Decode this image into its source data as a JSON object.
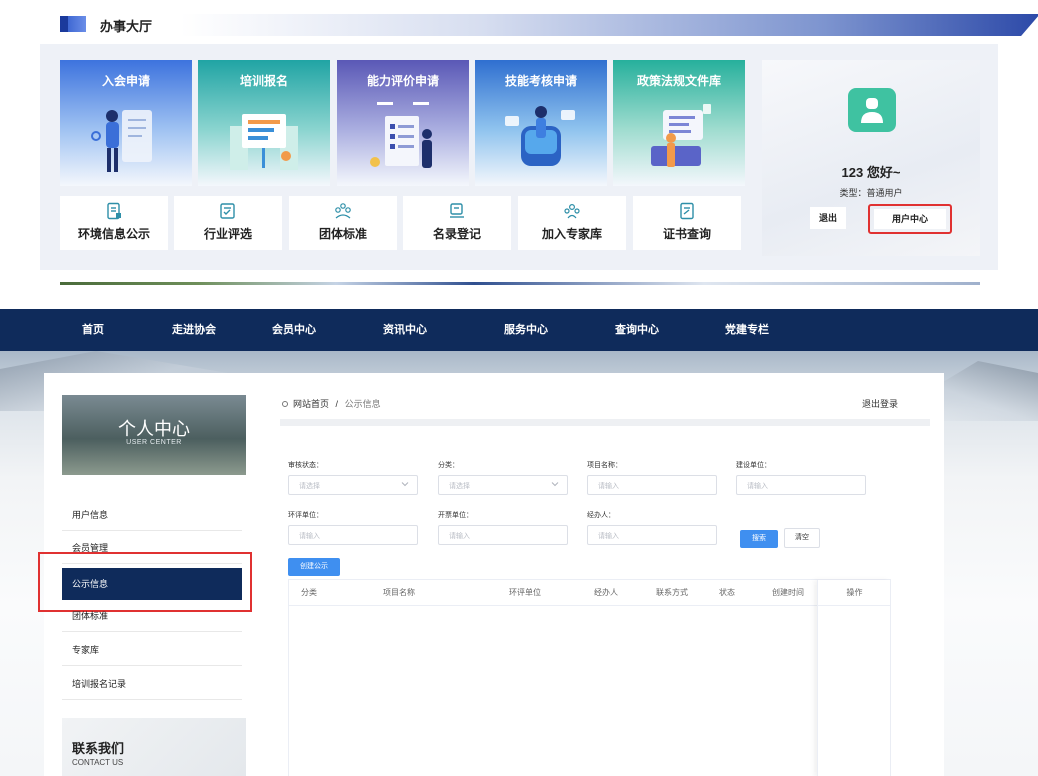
{
  "hall": {
    "title": "办事大厅",
    "tiles": [
      {
        "label": "入会申请",
        "icon": "member-application-icon"
      },
      {
        "label": "培训报名",
        "icon": "training-registration-icon"
      },
      {
        "label": "能力评价申请",
        "icon": "ability-evaluation-icon"
      },
      {
        "label": "技能考核申请",
        "icon": "skill-assessment-icon"
      },
      {
        "label": "政策法规文件库",
        "icon": "policy-library-icon"
      }
    ],
    "services": [
      {
        "label": "环境信息公示",
        "icon": "document-icon"
      },
      {
        "label": "行业评选",
        "icon": "checklist-icon"
      },
      {
        "label": "团体标准",
        "icon": "group-icon"
      },
      {
        "label": "名录登记",
        "icon": "registry-icon"
      },
      {
        "label": "加入专家库",
        "icon": "experts-icon"
      },
      {
        "label": "证书查询",
        "icon": "certificate-icon"
      }
    ],
    "user": {
      "greeting": "123 您好~",
      "type": "类型：普通用户",
      "logout": "退出",
      "user_center": "用户中心"
    }
  },
  "nav": {
    "items": [
      "首页",
      "走进协会",
      "会员中心",
      "资讯中心",
      "服务中心",
      "查询中心",
      "党建专栏"
    ]
  },
  "sidebar": {
    "title": "个人中心",
    "subtitle": "USER CENTER",
    "items": [
      "用户信息",
      "会员管理",
      "公示信息",
      "团体标准",
      "专家库",
      "培训报名记录"
    ],
    "active_index": 2,
    "contact_title": "联系我们",
    "contact_sub": "CONTACT US"
  },
  "breadcrumb": {
    "home": "网站首页",
    "separator": "/",
    "current": "公示信息"
  },
  "logout_link": "退出登录",
  "filters": {
    "audit_status": {
      "label": "审核状态：",
      "placeholder": "请选择"
    },
    "category": {
      "label": "分类：",
      "placeholder": "请选择"
    },
    "project_name": {
      "label": "项目名称：",
      "placeholder": "请输入"
    },
    "builder": {
      "label": "建设单位：",
      "placeholder": "请输入"
    },
    "eia_unit": {
      "label": "环评单位：",
      "placeholder": "请输入"
    },
    "invoice_unit": {
      "label": "开票单位：",
      "placeholder": "请输入"
    },
    "handler": {
      "label": "经办人：",
      "placeholder": "请输入"
    },
    "search_button": "搜索",
    "clear_button": "清空"
  },
  "create_button": "创建公示",
  "table": {
    "columns": [
      "分类",
      "项目名称",
      "环评单位",
      "经办人",
      "联系方式",
      "状态",
      "创建时间",
      "操作"
    ],
    "rows": []
  },
  "colors": {
    "nav_bg": "#0f2b5b",
    "primary": "#3f8ff0",
    "highlight": "#e03131"
  }
}
